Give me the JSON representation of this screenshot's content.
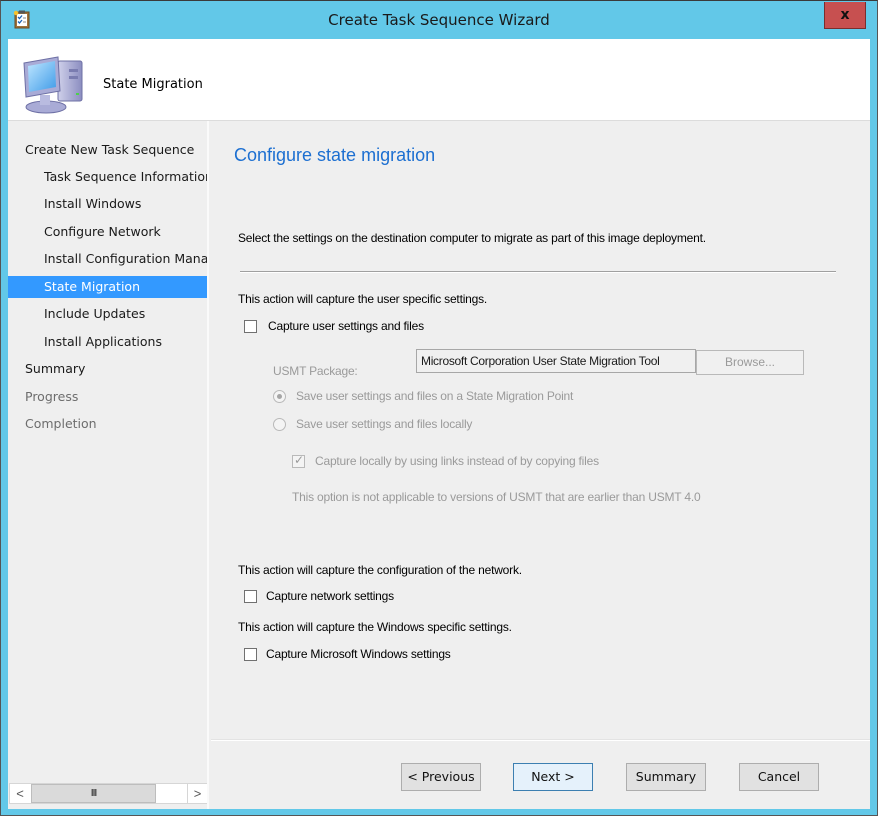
{
  "window": {
    "title": "Create Task Sequence Wizard",
    "close_label": "x"
  },
  "header": {
    "title": "State Migration",
    "icon": "computer-icon"
  },
  "nav": {
    "items": [
      {
        "label": "Create New Task Sequence",
        "level": 0,
        "state": "normal"
      },
      {
        "label": "Task Sequence Information",
        "level": 1,
        "state": "normal"
      },
      {
        "label": "Install Windows",
        "level": 1,
        "state": "normal"
      },
      {
        "label": "Configure Network",
        "level": 1,
        "state": "normal"
      },
      {
        "label": "Install Configuration Manager",
        "level": 1,
        "state": "normal"
      },
      {
        "label": "State Migration",
        "level": 1,
        "state": "selected"
      },
      {
        "label": "Include Updates",
        "level": 1,
        "state": "normal"
      },
      {
        "label": "Install Applications",
        "level": 1,
        "state": "normal"
      },
      {
        "label": "Summary",
        "level": 0,
        "state": "normal"
      },
      {
        "label": "Progress",
        "level": 0,
        "state": "dim"
      },
      {
        "label": "Completion",
        "level": 0,
        "state": "dim"
      }
    ],
    "scrollbar": {
      "left_arrow": "<",
      "right_arrow": ">",
      "thumb_grip": "III"
    }
  },
  "main": {
    "title": "Configure state migration",
    "description": "Select the settings on the destination computer to migrate as part of this image deployment.",
    "user_section": {
      "intro": "This action will capture the user specific settings.",
      "capture_checkbox": {
        "label": "Capture user settings and files",
        "checked": false
      },
      "usmt_label": "USMT Package:",
      "usmt_value": "Microsoft Corporation User State Migration Tool",
      "browse_label": "Browse...",
      "radio_smp": {
        "label": "Save user settings and files on a State Migration Point",
        "selected": true
      },
      "radio_local": {
        "label": "Save user settings and files locally",
        "selected": false
      },
      "links_checkbox": {
        "label": "Capture locally by using links instead of by copying files",
        "checked": true
      },
      "note": "This option is not applicable to versions of USMT that are earlier than USMT 4.0"
    },
    "network_section": {
      "intro": "This action will capture the configuration of the network.",
      "checkbox": {
        "label": "Capture network settings",
        "checked": false
      }
    },
    "windows_section": {
      "intro": "This action will capture the Windows specific settings.",
      "checkbox": {
        "label": "Capture Microsoft Windows settings",
        "checked": false
      }
    }
  },
  "footer": {
    "previous_label": "< Previous",
    "next_label": "Next >",
    "summary_label": "Summary",
    "cancel_label": "Cancel"
  }
}
